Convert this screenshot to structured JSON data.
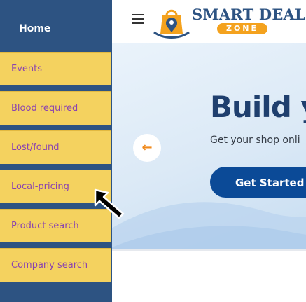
{
  "sidebar": {
    "home_label": "Home",
    "items": [
      {
        "label": "Events"
      },
      {
        "label": "Blood required"
      },
      {
        "label": "Lost/found"
      },
      {
        "label": "Local-pricing"
      },
      {
        "label": "Product search"
      },
      {
        "label": "Company search"
      }
    ]
  },
  "header": {
    "brand_title": "SMART DEAL",
    "brand_badge": "ZONE",
    "icons": [
      "menu-icon",
      "shopping-bag-location-logo"
    ]
  },
  "hero": {
    "title": "Build y",
    "subtitle": "Get your shop onli",
    "cta_label": "Get Started",
    "prev_icon": "←"
  },
  "colors": {
    "sidebar": "#2d5382",
    "menu_item": "#f4d25f",
    "menu_text": "#8a43b0",
    "cta": "#0b4a97",
    "accent": "#f4a21e"
  }
}
